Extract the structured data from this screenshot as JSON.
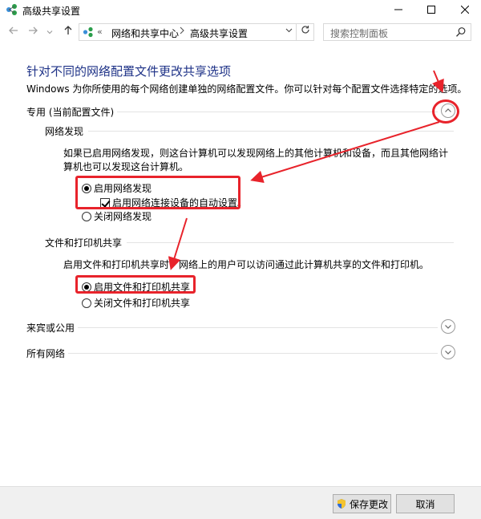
{
  "window": {
    "title": "高级共享设置"
  },
  "address": {
    "chevrons": "«",
    "crumbs": [
      "网络和共享中心",
      "高级共享设置"
    ],
    "search_placeholder": "搜索控制面板"
  },
  "page": {
    "title": "针对不同的网络配置文件更改共享选项",
    "description": "Windows 为你所使用的每个网络创建单独的网络配置文件。你可以针对每个配置文件选择特定的选项。"
  },
  "sections": {
    "private": {
      "label": "专用 (当前配置文件)",
      "network_discovery": {
        "heading": "网络发现",
        "description": "如果已启用网络发现，则这台计算机可以发现网络上的其他计算机和设备，而且其他网络计算机也可以发现这台计算机。",
        "on_label": "启用网络发现",
        "auto_setup_label": "启用网络连接设备的自动设置。",
        "off_label": "关闭网络发现"
      },
      "file_printer": {
        "heading": "文件和打印机共享",
        "description": "启用文件和打印机共享时，网络上的用户可以访问通过此计算机共享的文件和打印机。",
        "on_label": "启用文件和打印机共享",
        "off_label": "关闭文件和打印机共享"
      }
    },
    "guest": {
      "label": "来宾或公用"
    },
    "all": {
      "label": "所有网络"
    }
  },
  "footer": {
    "save_label": "保存更改",
    "cancel_label": "取消"
  },
  "colors": {
    "title_blue": "#1e3287",
    "annotation_red": "#e8232b"
  }
}
